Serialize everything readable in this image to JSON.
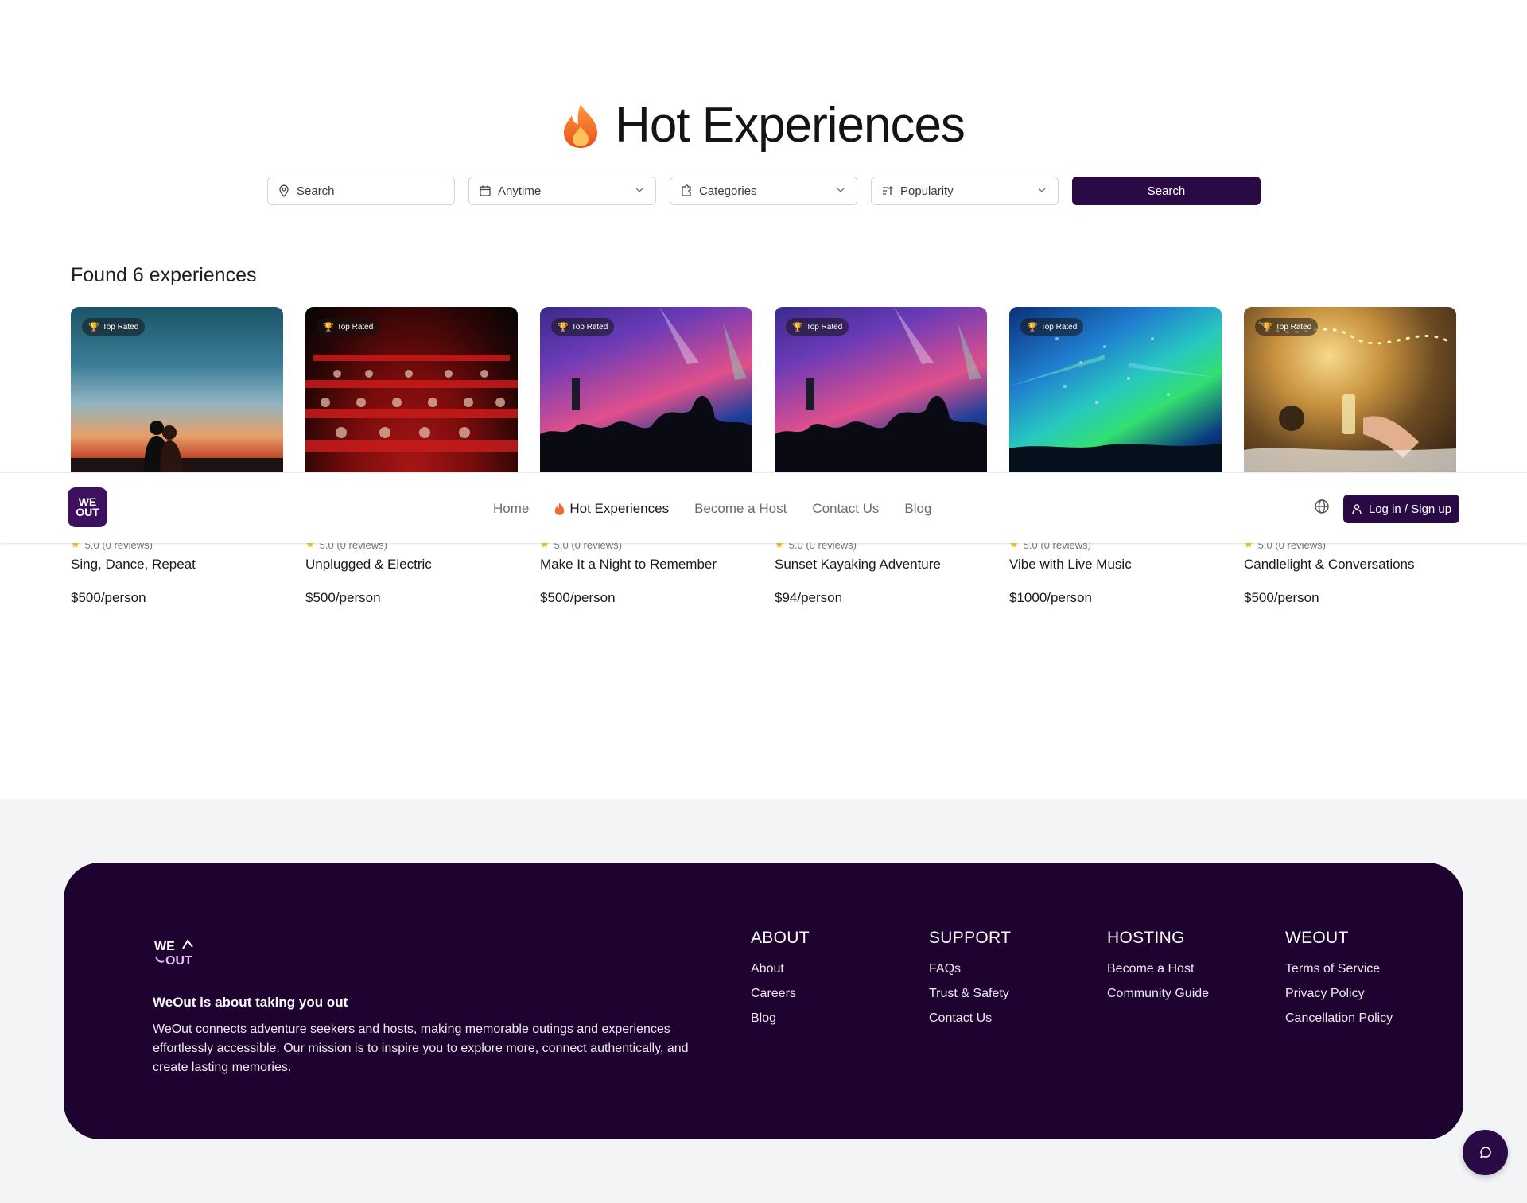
{
  "hero": {
    "title": "Hot Experiences",
    "icon": "flame-icon"
  },
  "filters": {
    "search_placeholder": "Search",
    "date_label": "Anytime",
    "category_label": "Categories",
    "sort_label": "Popularity",
    "search_button": "Search"
  },
  "results": {
    "found_text": "Found 6 experiences"
  },
  "cards": [
    {
      "badge": "Top Rated",
      "rating": "5.0 (0 reviews)",
      "title": "Sing, Dance, Repeat",
      "price": "$500/person"
    },
    {
      "badge": "Top Rated",
      "rating": "5.0 (0 reviews)",
      "title": "Unplugged & Electric",
      "price": "$500/person"
    },
    {
      "badge": "Top Rated",
      "rating": "5.0 (0 reviews)",
      "title": "Make It a Night to Remember",
      "price": "$500/person"
    },
    {
      "badge": "Top Rated",
      "rating": "5.0 (0 reviews)",
      "title": "Sunset Kayaking Adventure",
      "price": "$94/person"
    },
    {
      "badge": "Top Rated",
      "rating": "5.0 (0 reviews)",
      "title": "Vibe with Live Music",
      "price": "$1000/person"
    },
    {
      "badge": "Top Rated",
      "rating": "5.0 (0 reviews)",
      "title": "Candlelight & Conversations",
      "price": "$500/person"
    }
  ],
  "nav": {
    "logo_text": "WE OUT",
    "links": [
      "Home",
      "Hot Experiences",
      "Become a Host",
      "Contact Us",
      "Blog"
    ],
    "login_label": "Log in / Sign up"
  },
  "footer": {
    "tagline": "WeOut is about taking you out",
    "description": "WeOut connects adventure seekers and hosts, making memorable outings and experiences effortlessly accessible. Our mission is to inspire you to explore more, connect authentically, and create lasting memories.",
    "columns": [
      {
        "heading": "ABOUT",
        "links": [
          "About",
          "Careers",
          "Blog"
        ]
      },
      {
        "heading": "SUPPORT",
        "links": [
          "FAQs",
          "Trust & Safety",
          "Contact Us"
        ]
      },
      {
        "heading": "HOSTING",
        "links": [
          "Become a Host",
          "Community Guide"
        ]
      },
      {
        "heading": "WEOUT",
        "links": [
          "Terms of Service",
          "Privacy Policy",
          "Cancellation Policy"
        ]
      }
    ]
  },
  "colors": {
    "brand": "#2a0a45",
    "footer": "#1e0330",
    "star": "#f5c518"
  }
}
